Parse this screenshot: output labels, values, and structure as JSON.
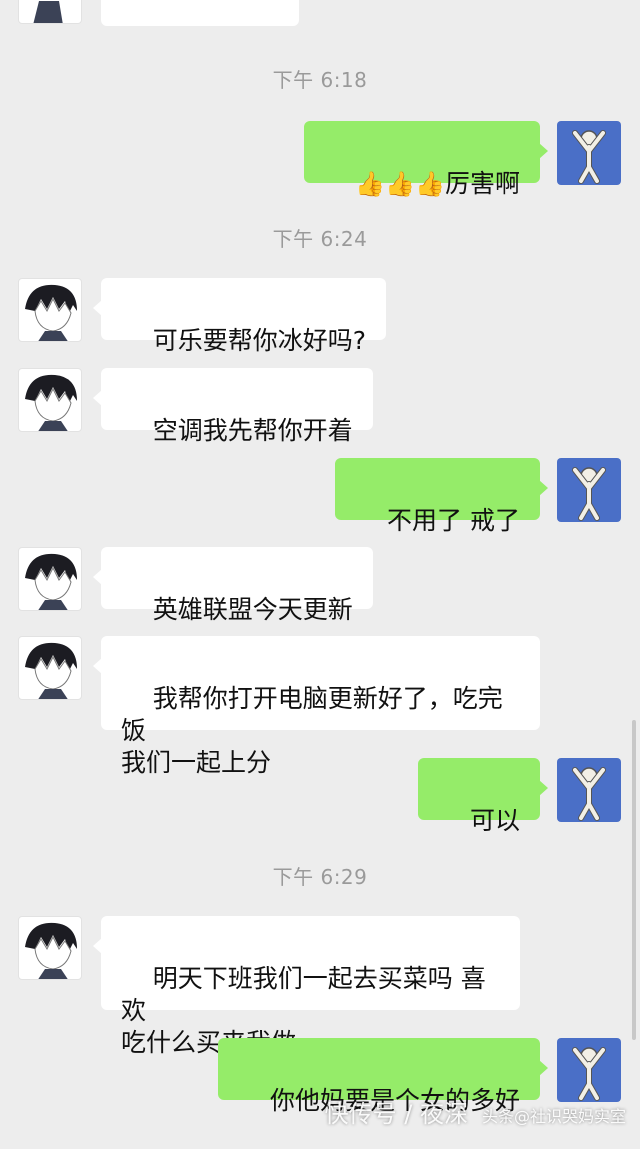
{
  "timestamps": [
    "下午 6:18",
    "下午 6:24",
    "下午 6:29"
  ],
  "messages": [
    {
      "side": "out",
      "text": "厉害啊",
      "emoji": [
        "👍",
        "👍",
        "👍"
      ]
    },
    {
      "side": "in",
      "text": "可乐要帮你冰好吗?"
    },
    {
      "side": "in",
      "text": "空调我先帮你开着"
    },
    {
      "side": "out",
      "text": "不用了 戒了"
    },
    {
      "side": "in",
      "text": "英雄联盟今天更新"
    },
    {
      "side": "in",
      "text": "我帮你打开电脑更新好了，吃完饭\n我们一起上分"
    },
    {
      "side": "out",
      "text": "可以"
    },
    {
      "side": "in",
      "text": "明天下班我们一起去买菜吗 喜欢\n吃什么买来我做"
    },
    {
      "side": "out",
      "text": "你他妈要是个女的多好"
    }
  ],
  "watermark": {
    "left": "快传号 / 夜深",
    "right": "头条@社识哭妈实室"
  },
  "colors": {
    "background": "#ededed",
    "outgoing_bubble": "#95ec69",
    "incoming_bubble": "#ffffff",
    "my_avatar": "#4a6fc7"
  }
}
